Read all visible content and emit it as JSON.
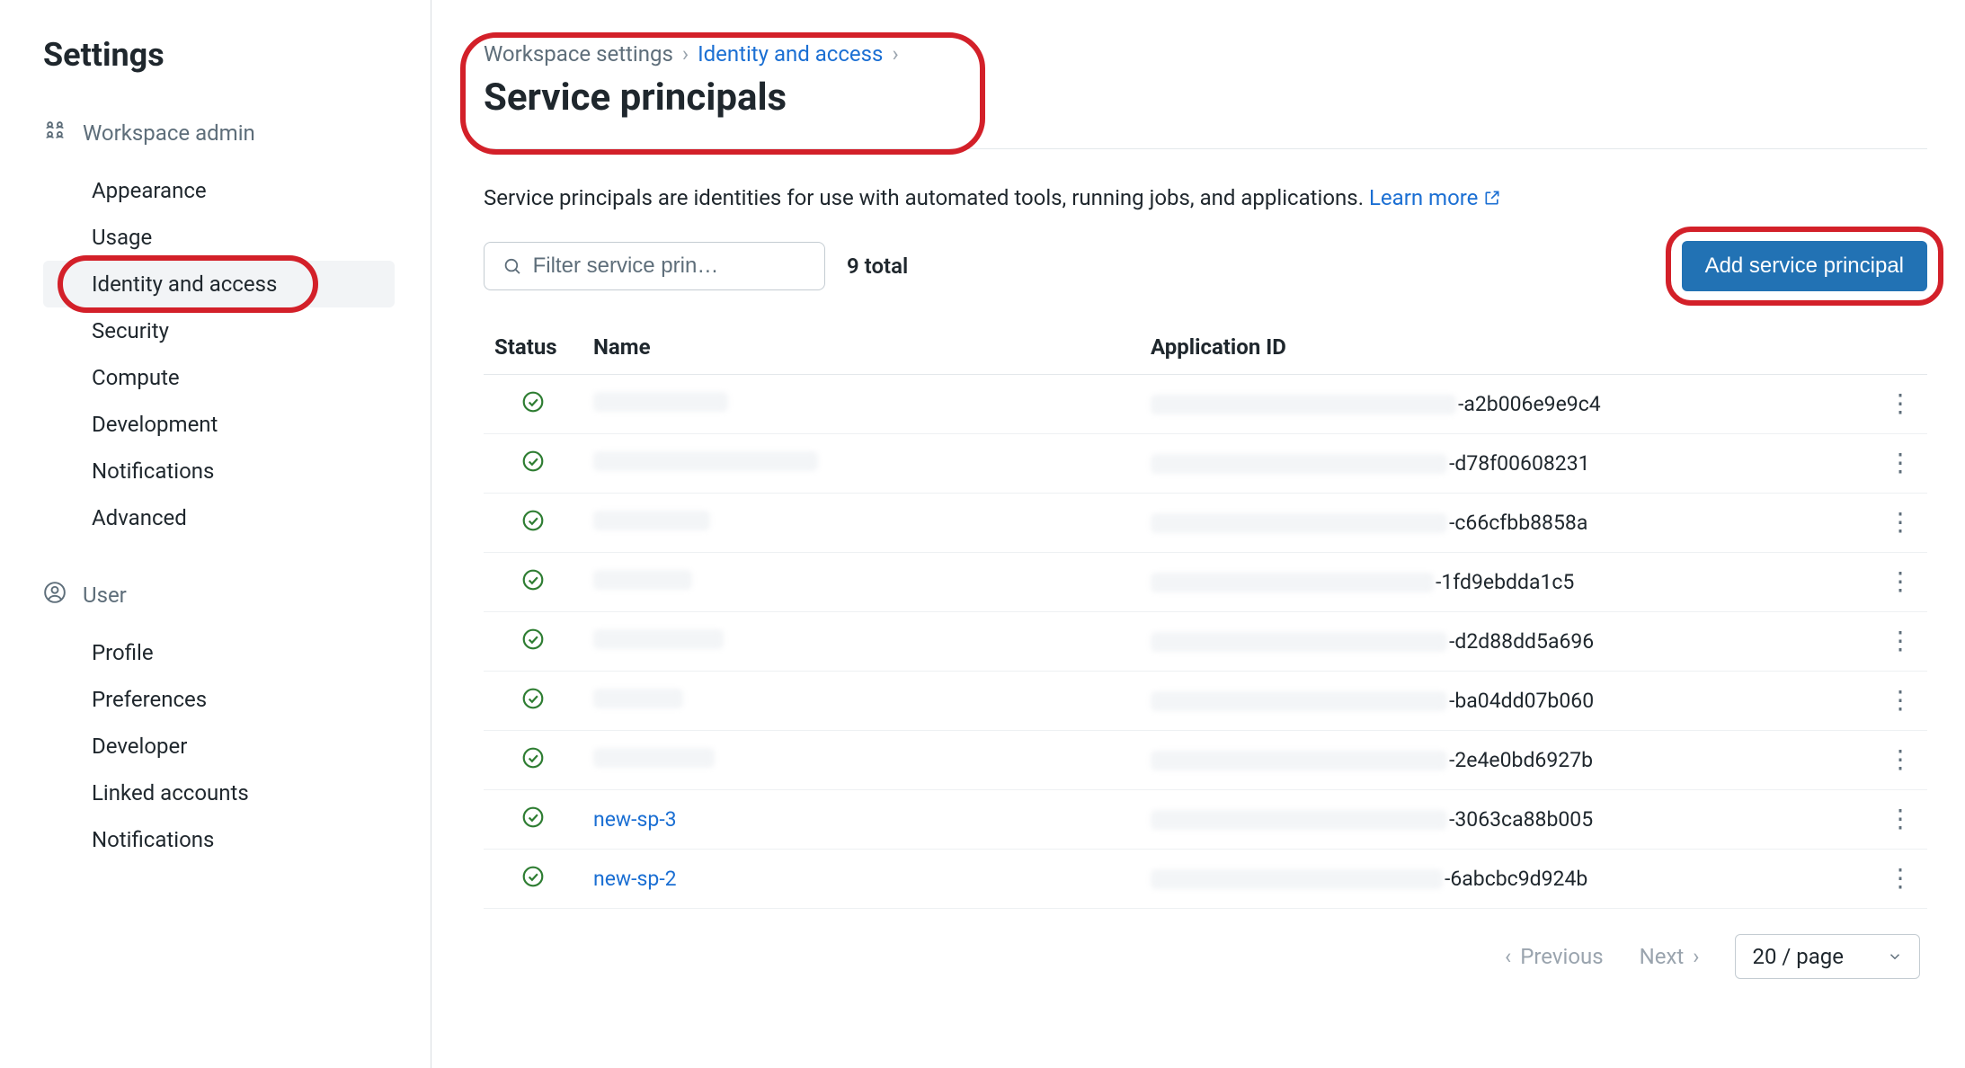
{
  "sidebar": {
    "title": "Settings",
    "sections": [
      {
        "header": "Workspace admin",
        "icon": "workspace-admin-icon",
        "items": [
          {
            "label": "Appearance",
            "selected": false
          },
          {
            "label": "Usage",
            "selected": false
          },
          {
            "label": "Identity and access",
            "selected": true
          },
          {
            "label": "Security",
            "selected": false
          },
          {
            "label": "Compute",
            "selected": false
          },
          {
            "label": "Development",
            "selected": false
          },
          {
            "label": "Notifications",
            "selected": false
          },
          {
            "label": "Advanced",
            "selected": false
          }
        ]
      },
      {
        "header": "User",
        "icon": "user-icon",
        "items": [
          {
            "label": "Profile",
            "selected": false
          },
          {
            "label": "Preferences",
            "selected": false
          },
          {
            "label": "Developer",
            "selected": false
          },
          {
            "label": "Linked accounts",
            "selected": false
          },
          {
            "label": "Notifications",
            "selected": false
          }
        ]
      }
    ]
  },
  "breadcrumb": {
    "items": [
      {
        "label": "Workspace settings",
        "link": false
      },
      {
        "label": "Identity and access",
        "link": true
      }
    ]
  },
  "page": {
    "title": "Service principals",
    "intro_text": "Service principals are identities for use with automated tools, running jobs, and applications.",
    "learn_more": "Learn more"
  },
  "toolbar": {
    "filter_placeholder": "Filter service prin…",
    "total_label": "9 total",
    "add_button": "Add service principal"
  },
  "table": {
    "columns": {
      "status": "Status",
      "name": "Name",
      "appid": "Application ID"
    },
    "rows": [
      {
        "status": "ok",
        "name": "",
        "name_redacted": true,
        "name_width": 150,
        "appid_prefix_width": 340,
        "appid_suffix": "-a2b006e9e9c4"
      },
      {
        "status": "ok",
        "name": "",
        "name_redacted": true,
        "name_width": 250,
        "appid_prefix_width": 330,
        "appid_suffix": "-d78f00608231"
      },
      {
        "status": "ok",
        "name": "",
        "name_redacted": true,
        "name_width": 130,
        "appid_prefix_width": 330,
        "appid_suffix": "-c66cfbb8858a"
      },
      {
        "status": "ok",
        "name": "",
        "name_redacted": true,
        "name_width": 110,
        "appid_prefix_width": 315,
        "appid_suffix": "-1fd9ebdda1c5"
      },
      {
        "status": "ok",
        "name": "",
        "name_redacted": true,
        "name_width": 145,
        "appid_prefix_width": 330,
        "appid_suffix": "-d2d88dd5a696"
      },
      {
        "status": "ok",
        "name": "",
        "name_redacted": true,
        "name_width": 100,
        "appid_prefix_width": 330,
        "appid_suffix": "-ba04dd07b060"
      },
      {
        "status": "ok",
        "name": "",
        "name_redacted": true,
        "name_width": 135,
        "appid_prefix_width": 330,
        "appid_suffix": "-2e4e0bd6927b"
      },
      {
        "status": "ok",
        "name": "new-sp-3",
        "name_redacted": false,
        "name_link": true,
        "appid_prefix_width": 330,
        "appid_suffix": "-3063ca88b005"
      },
      {
        "status": "ok",
        "name": "new-sp-2",
        "name_redacted": false,
        "name_link": true,
        "appid_prefix_width": 325,
        "appid_suffix": "-6abcbc9d924b"
      }
    ]
  },
  "pager": {
    "prev": "Previous",
    "next": "Next",
    "page_size": "20 / page"
  },
  "annotations": {
    "header_ring": true,
    "sidebar_item_ring_index": 2,
    "add_button_ring": true
  }
}
